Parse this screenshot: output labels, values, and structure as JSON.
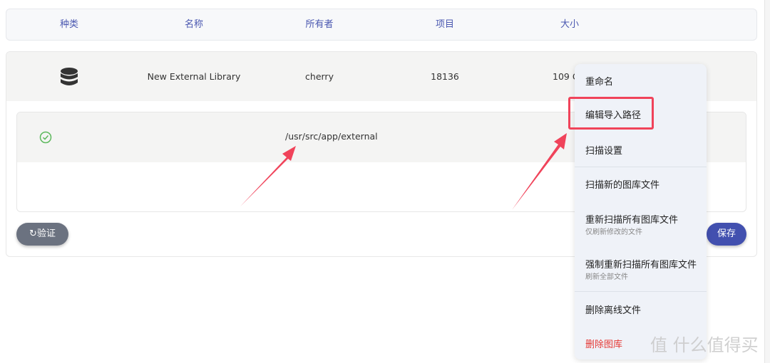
{
  "table": {
    "headers": [
      "种类",
      "名称",
      "所有者",
      "项目",
      "大小"
    ]
  },
  "library": {
    "name": "New External Library",
    "owner": "cherry",
    "items": "18136",
    "size": "109 G"
  },
  "import_path": {
    "path": "/usr/src/app/external"
  },
  "buttons": {
    "validate": "验证",
    "save": "保存"
  },
  "menu": {
    "rename": "重命名",
    "edit_import_paths": "编辑导入路径",
    "scan_settings": "扫描设置",
    "scan_new": "扫描新的图库文件",
    "rescan_all": "重新扫描所有图库文件",
    "rescan_all_sub": "仅刷新修改的文件",
    "force_rescan": "强制重新扫描所有图库文件",
    "force_rescan_sub": "刷新全部文件",
    "remove_offline": "删除离线文件",
    "delete_library": "删除图库"
  },
  "watermark": "值 什么值得买",
  "colors": {
    "accent": "#4250af",
    "danger": "#e53935",
    "annotation": "#f0435a"
  }
}
